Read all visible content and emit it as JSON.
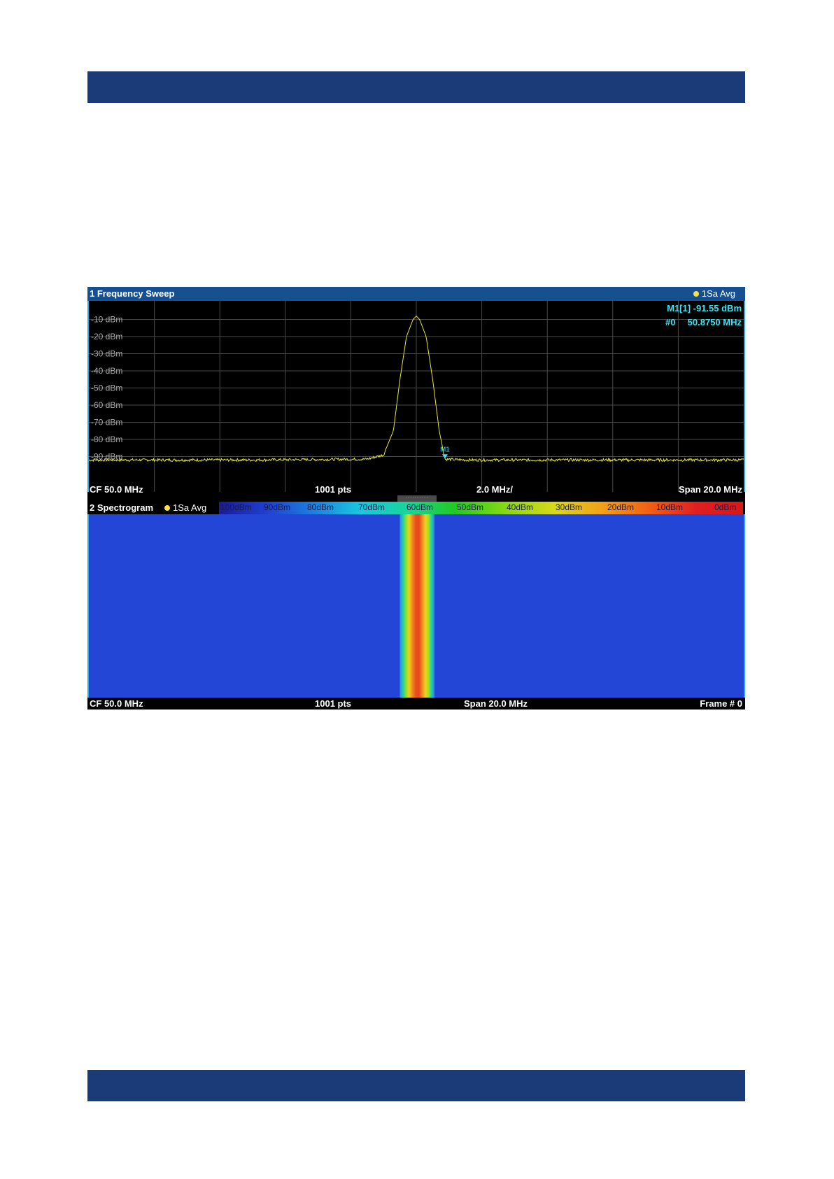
{
  "window1": {
    "title": "1 Frequency Sweep",
    "trace_tag": "1Sa Avg",
    "marker_readout_line1": "M1[1]   -91.55 dBm",
    "marker_readout_line2_left": "#0",
    "marker_readout_line2_right": "50.8750 MHz",
    "marker_label": "M1",
    "y_labels": [
      "-10 dBm",
      "-20 dBm",
      "-30 dBm",
      "-40 dBm",
      "-50 dBm",
      "-60 dBm",
      "-70 dBm",
      "-80 dBm",
      "-90 dBm"
    ],
    "status": {
      "center": "CF 50.0 MHz",
      "points": "1001 pts",
      "per_div": "2.0 MHz/",
      "span": "Span 20.0 MHz"
    }
  },
  "window2": {
    "title": "2 Spectrogram",
    "trace_tag": "1Sa Avg",
    "colorbar_labels": [
      "100dBm",
      "90dBm",
      "80dBm",
      "70dBm",
      "60dBm",
      "50dBm",
      "40dBm",
      "30dBm",
      "20dBm",
      "10dBm",
      "0dBm"
    ],
    "status": {
      "center": "CF 50.0 MHz",
      "points": "1001 pts",
      "span": "Span 20.0 MHz",
      "frame": "Frame # 0"
    }
  },
  "colors": {
    "header_band": "#1b3a78",
    "window_title_bar": "#16508f",
    "trace": "#e8e83a",
    "marker": "#3fe1f0",
    "spectrogram_floor": "#2446d6"
  },
  "chart_data": {
    "type": "line",
    "title": "1 Frequency Sweep",
    "xlabel": "",
    "ylabel": "",
    "x_unit": "MHz",
    "y_unit": "dBm",
    "xlim": [
      40.0,
      60.0
    ],
    "ylim": [
      -100,
      0
    ],
    "series": [
      {
        "name": "1Sa Avg",
        "points": [
          [
            40.0,
            -92
          ],
          [
            45.0,
            -92
          ],
          [
            48.5,
            -91.5
          ],
          [
            49.0,
            -89
          ],
          [
            49.3,
            -75
          ],
          [
            49.5,
            -45
          ],
          [
            49.7,
            -20
          ],
          [
            49.9,
            -10
          ],
          [
            50.0,
            -8
          ],
          [
            50.1,
            -10
          ],
          [
            50.3,
            -20
          ],
          [
            50.5,
            -45
          ],
          [
            50.7,
            -75
          ],
          [
            50.875,
            -91.55
          ],
          [
            51.5,
            -92
          ],
          [
            55.0,
            -92
          ],
          [
            60.0,
            -92
          ]
        ]
      }
    ],
    "markers": [
      {
        "name": "M1",
        "x": 50.875,
        "y": -91.55
      }
    ],
    "grid": true
  }
}
